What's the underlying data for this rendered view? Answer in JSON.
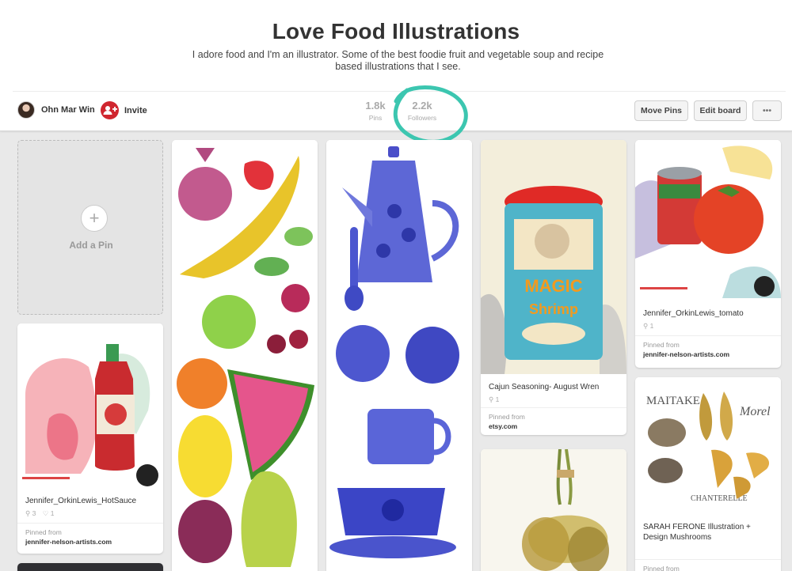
{
  "board": {
    "title": "Love Food Illustrations",
    "description": "I adore food and I'm an illustrator. Some of the best foodie fruit and vegetable soup and recipe based illustrations that I see."
  },
  "owner": {
    "name": "Ohn Mar Win"
  },
  "invite": {
    "label": "Invite"
  },
  "stats": {
    "pins": {
      "count": "1.8k",
      "label": "Pins"
    },
    "followers": {
      "count": "2.2k",
      "label": "Followers"
    }
  },
  "actions": {
    "move_pins": "Move Pins",
    "edit_board": "Edit board",
    "more": "•••"
  },
  "add_pin": {
    "label": "Add a Pin"
  },
  "pins": [
    {
      "title": "Jennifer_OrkinLewis_HotSauce",
      "repins": "3",
      "likes": "1",
      "source_label": "Pinned from",
      "source": "jennifer-nelson-artists.com"
    },
    {
      "title": "Cajun Seasoning- August Wren",
      "repins": "1",
      "source_label": "Pinned from",
      "source": "etsy.com"
    },
    {
      "title": "Jennifer_OrkinLewis_tomato",
      "repins": "1",
      "source_label": "Pinned from",
      "source": "jennifer-nelson-artists.com"
    },
    {
      "title": "SARAH FERONE Illustration + Design Mushrooms",
      "source_label": "Pinned from"
    }
  ],
  "icons": {
    "repin": "pin-icon",
    "like": "heart-icon",
    "plus": "plus-icon"
  },
  "colors": {
    "invite": "#d0262f",
    "annotation": "#3cc6b0"
  }
}
